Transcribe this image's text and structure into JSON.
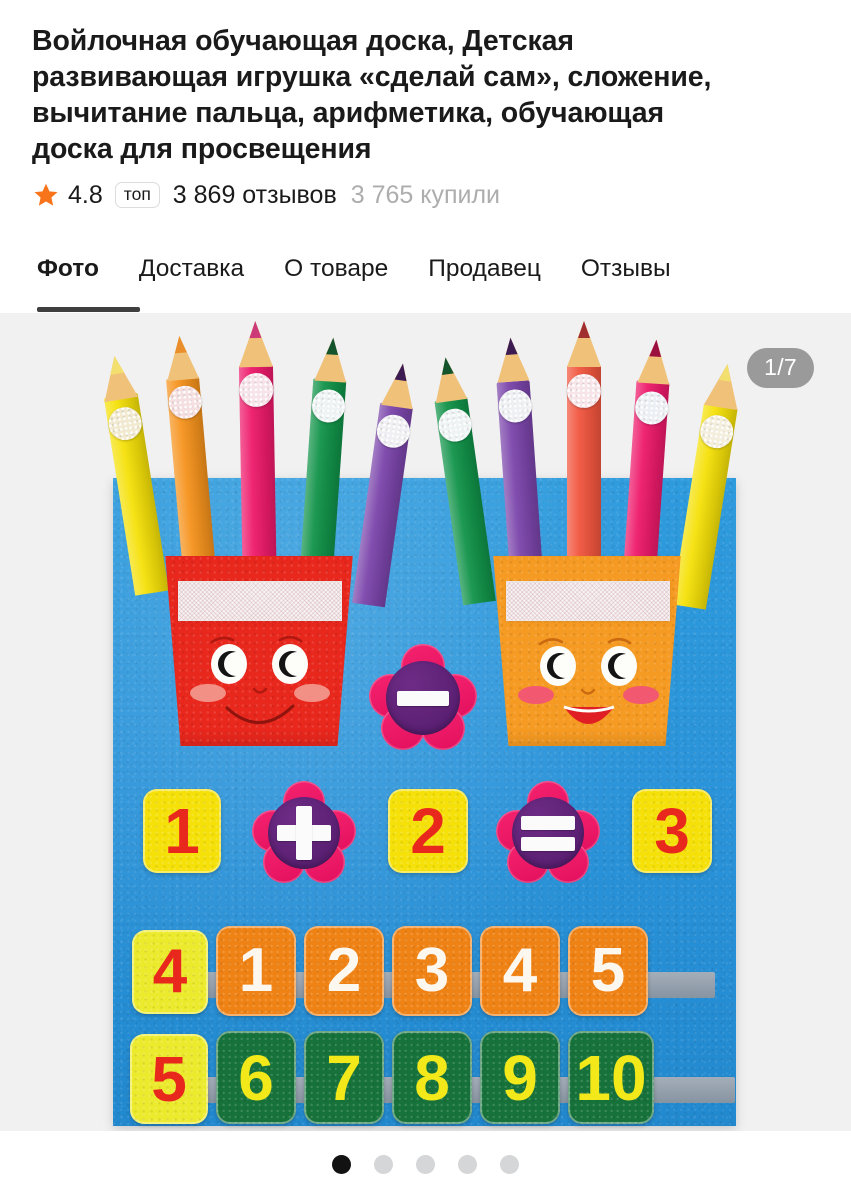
{
  "product": {
    "title": "Войлочная обучающая доска, Детская развивающая игрушка «сделай сам», сложение, вычитание пальца, арифметика, обучающая доска для просвещения"
  },
  "rating": {
    "star_icon": "star-icon",
    "value": "4.8",
    "top_badge": "топ",
    "reviews": "3 869 отзывов",
    "bought": "3 765 купили",
    "star_color": "#f8741a",
    "muted_color": "#adadad"
  },
  "tabs": [
    {
      "label": "Фото",
      "active": true
    },
    {
      "label": "Доставка",
      "active": false
    },
    {
      "label": "О товаре",
      "active": false
    },
    {
      "label": "Продавец",
      "active": false
    },
    {
      "label": "Отзывы",
      "active": false
    }
  ],
  "gallery": {
    "counter": "1/7",
    "background_color": "#f1f1f1",
    "dots": [
      {
        "active": true
      },
      {
        "active": false
      },
      {
        "active": false
      },
      {
        "active": false
      },
      {
        "active": false
      }
    ]
  },
  "product_photo": {
    "board_color": "#2b94da",
    "left_cup": {
      "color": "#e8271d",
      "expression": "smile-closed",
      "pencils": [
        "#f5e109",
        "#f6931d",
        "#ee1a6b",
        "#119349",
        "#7b45ab"
      ]
    },
    "right_cup": {
      "color": "#f59a22",
      "expression": "smile-open",
      "pencils": [
        "#119349",
        "#7b45ab",
        "#f2563f",
        "#ee1a6b",
        "#f5e109"
      ]
    },
    "minus_flower": {
      "operator": "−",
      "petal_color": "#e20f5e",
      "center_color": "#5a1f72"
    },
    "equation_row": [
      {
        "kind": "tile",
        "value": "1",
        "tile_color": "#f5e109",
        "text_color": "#e8271d"
      },
      {
        "kind": "flower",
        "value": "+",
        "petal_color": "#e20f5e",
        "center_color": "#5a1f72"
      },
      {
        "kind": "tile",
        "value": "2",
        "tile_color": "#f5e109",
        "text_color": "#e8271d"
      },
      {
        "kind": "flower",
        "value": "=",
        "petal_color": "#e20f5e",
        "center_color": "#5a1f72"
      },
      {
        "kind": "tile",
        "value": "3",
        "tile_color": "#f5e109",
        "text_color": "#e8271d"
      }
    ],
    "number_row_1": [
      {
        "value": "4",
        "tile_color": "#ecea2c",
        "text_color": "#e8271d"
      },
      {
        "value": "1",
        "tile_color": "#ef8214",
        "text_color": "#fdf8ef"
      },
      {
        "value": "2",
        "tile_color": "#ef8214",
        "text_color": "#fdf8ef"
      },
      {
        "value": "3",
        "tile_color": "#ef8214",
        "text_color": "#fdf8ef"
      },
      {
        "value": "4",
        "tile_color": "#ef8214",
        "text_color": "#fdf8ef"
      },
      {
        "value": "5",
        "tile_color": "#ef8214",
        "text_color": "#fdf8ef"
      }
    ],
    "number_row_2": [
      {
        "value": "5",
        "tile_color": "#ecea2c",
        "text_color": "#e8271d"
      },
      {
        "value": "6",
        "tile_color": "#16723a",
        "text_color": "#f3e819"
      },
      {
        "value": "7",
        "tile_color": "#16723a",
        "text_color": "#f3e819"
      },
      {
        "value": "8",
        "tile_color": "#16723a",
        "text_color": "#f3e819"
      },
      {
        "value": "9",
        "tile_color": "#16723a",
        "text_color": "#f3e819"
      },
      {
        "value": "10",
        "tile_color": "#16723a",
        "text_color": "#f3e819"
      }
    ]
  }
}
